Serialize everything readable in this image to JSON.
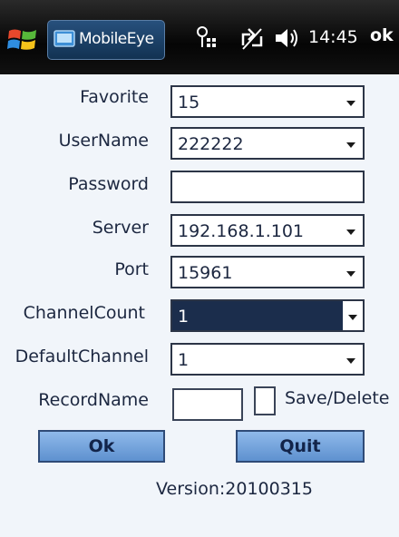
{
  "taskbar": {
    "app_title": "MobileEye",
    "clock": "14:45",
    "ok_label": "ok",
    "icons": [
      "windows-start-icon",
      "app-icon",
      "network-icon",
      "connectivity-icon",
      "volume-icon"
    ]
  },
  "form": {
    "favorite": {
      "label": "Favorite",
      "value": "15"
    },
    "username": {
      "label": "UserName",
      "value": "222222"
    },
    "password": {
      "label": "Password",
      "value": ""
    },
    "server": {
      "label": "Server",
      "value": "192.168.1.101"
    },
    "port": {
      "label": "Port",
      "value": "15961"
    },
    "channel_count": {
      "label": "ChannelCount",
      "value": "1"
    },
    "default_channel": {
      "label": "DefaultChannel",
      "value": "1"
    },
    "record_name": {
      "label": "RecordName",
      "value": ""
    },
    "save_delete_label": "Save/Delete"
  },
  "buttons": {
    "ok_label": "Ok",
    "quit_label": "Quit"
  },
  "version": "Version:20100315",
  "colors": {
    "taskbar": "#0a0a0a",
    "background": "#f1f5fa",
    "button": "#7aa8e0",
    "selected_field": "#1b2d4c"
  }
}
